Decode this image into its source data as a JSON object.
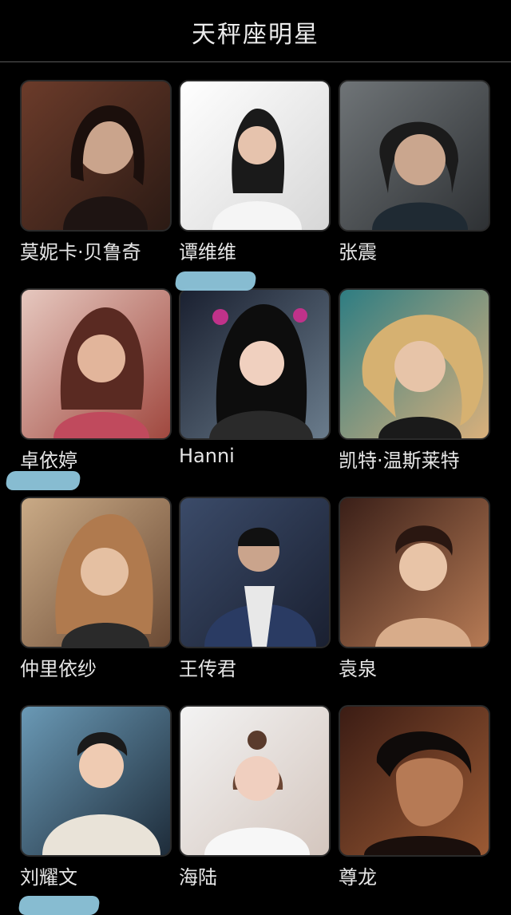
{
  "header": {
    "title": "天秤座明星"
  },
  "stars": [
    {
      "name": "莫妮卡·贝鲁奇",
      "colors": [
        "#6b3b2a",
        "#2b1a14"
      ]
    },
    {
      "name": "谭维维",
      "colors": [
        "#ffffff",
        "#d7d7d7"
      ]
    },
    {
      "name": "张震",
      "colors": [
        "#6f7477",
        "#2e3134"
      ]
    },
    {
      "name": "卓依婷",
      "colors": [
        "#e6c8bf",
        "#a0483f"
      ]
    },
    {
      "name": "Hanni",
      "colors": [
        "#1a2030",
        "#6a7c8c"
      ]
    },
    {
      "name": "凯特·温斯莱特",
      "colors": [
        "#2e7d82",
        "#d9b07c"
      ]
    },
    {
      "name": "仲里依纱",
      "colors": [
        "#c9aa86",
        "#6b4a34"
      ]
    },
    {
      "name": "王传君",
      "colors": [
        "#3b4b69",
        "#1a2031"
      ]
    },
    {
      "name": "袁泉",
      "colors": [
        "#3a1f18",
        "#b77b55"
      ]
    },
    {
      "name": "刘耀文",
      "colors": [
        "#6a99b5",
        "#1e2c3a"
      ]
    },
    {
      "name": "海陆",
      "colors": [
        "#f3f3f3",
        "#d4c6be"
      ]
    },
    {
      "name": "尊龙",
      "colors": [
        "#3b1c14",
        "#9b5a34"
      ]
    }
  ]
}
